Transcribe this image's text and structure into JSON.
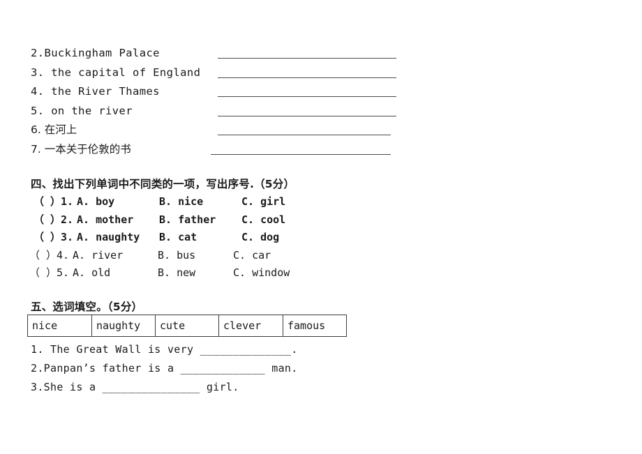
{
  "document": {
    "background_color": "#ffffff",
    "text_color": "#1a1a1a",
    "rule_color": "#4a4a4a",
    "table_border_color": "#3a3a3a"
  },
  "translation_exercise": {
    "items": [
      {
        "number": "2.",
        "text": "2.Buckingham Palace",
        "answer_value": ""
      },
      {
        "number": "3.",
        "text": "3. the capital of England",
        "answer_value": ""
      },
      {
        "number": "4.",
        "text": "4. the River Thames",
        "answer_value": ""
      },
      {
        "number": "5.",
        "text": "5. on the river",
        "answer_value": ""
      },
      {
        "number": "6.",
        "text": "6. 在河上",
        "answer_value": ""
      },
      {
        "number": "7.",
        "text": "7. 一本关于伦敦的书",
        "answer_value": ""
      }
    ]
  },
  "section_four": {
    "heading": "四、找出下列单词中不同类的一项，写出序号.（5分）",
    "questions": [
      {
        "paren": "（  ）1.",
        "a": "A. boy",
        "b": "B.  nice",
        "c": "C.  girl",
        "answer_value": ""
      },
      {
        "paren": "（  ）2.",
        "a": "A. mother",
        "b": "B.  father",
        "c": "C.  cool",
        "answer_value": ""
      },
      {
        "paren": "（  ）3.",
        "a": "A. naughty",
        "b": "B.  cat",
        "c": "C.  dog",
        "answer_value": ""
      },
      {
        "paren": "（  ）4.",
        "a": "A. river",
        "b": "B.  bus",
        "c": "C.  car",
        "answer_value": ""
      },
      {
        "paren": "（  ）5.",
        "a": "A. old",
        "b": "B.  new",
        "c": "C.  window",
        "answer_value": ""
      }
    ]
  },
  "section_five": {
    "heading": "五、选词填空。（5分）",
    "word_bank": [
      "nice",
      "naughty",
      "cute",
      "clever",
      "famous"
    ],
    "sentences": [
      {
        "text": "1.  The Great Wall is very ______________.",
        "answer_value": ""
      },
      {
        "text": "2.Panpan’s father is a _____________ man.",
        "answer_value": ""
      },
      {
        "text": "3.She is a _______________ girl.",
        "answer_value": ""
      }
    ]
  }
}
